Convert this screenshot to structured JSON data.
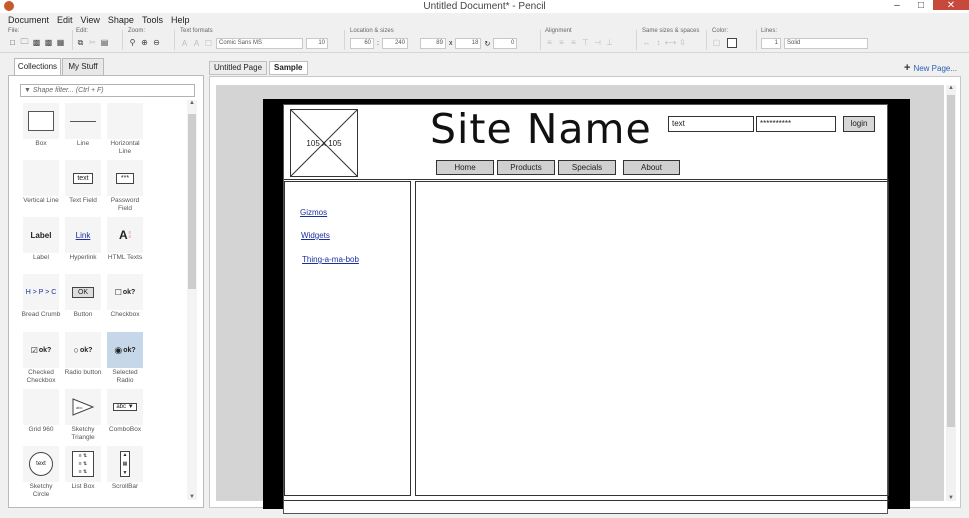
{
  "window": {
    "title": "Untitled Document* - Pencil"
  },
  "menu": [
    "Document",
    "Edit",
    "View",
    "Shape",
    "Tools",
    "Help"
  ],
  "toolbar": {
    "groups": {
      "file": "File:",
      "edit": "Edit:",
      "zoom": "Zoom:",
      "text": "Text formats",
      "location": "Location & sizes",
      "alignment": "Alignment",
      "same": "Same sizes & spaces",
      "color": "Color:",
      "lines": "Lines:"
    },
    "font_family": "Comic Sans MS",
    "font_size": "10",
    "x": "60",
    "y": "240",
    "w": "89",
    "h": "18",
    "angle": "0",
    "line_width": "1",
    "line_style": "Solid"
  },
  "left_panel": {
    "tabs": [
      "Collections",
      "My Stuff"
    ],
    "filter_placeholder": "Shape filter... (Ctrl + F)",
    "shapes": [
      [
        "Box",
        "Line",
        "Horizontal Line"
      ],
      [
        "Vertical Line",
        "Text Field",
        "Password Field"
      ],
      [
        "Label",
        "Hyperlink",
        "HTML Texts"
      ],
      [
        "Bread Crumb",
        "Button",
        "Checkbox"
      ],
      [
        "Checked Checkbox",
        "Radio button",
        "Selected Radio"
      ],
      [
        "Grid 960",
        "Sketchy Triangle",
        "ComboBox"
      ],
      [
        "Sketchy Circle",
        "List Box",
        "ScrollBar"
      ]
    ],
    "tile_texts": {
      "text": "text",
      "password": "***",
      "label": "Label",
      "link": "Link",
      "breadcrumb": "H > P > C",
      "ok": "OK",
      "ok2": "ok?",
      "abc": "abc"
    }
  },
  "doc_tabs": [
    "Untitled Page",
    "Sample"
  ],
  "new_page": "New Page...",
  "mockup": {
    "logo_label": "105 x 105",
    "site_name": "Site Name",
    "text_input": "text",
    "password_input": "**********",
    "login": "login",
    "nav": [
      "Home",
      "Products",
      "Specials",
      "About"
    ],
    "links": [
      "Gizmos",
      "Widgets",
      "Thing-a-ma-bob"
    ]
  }
}
